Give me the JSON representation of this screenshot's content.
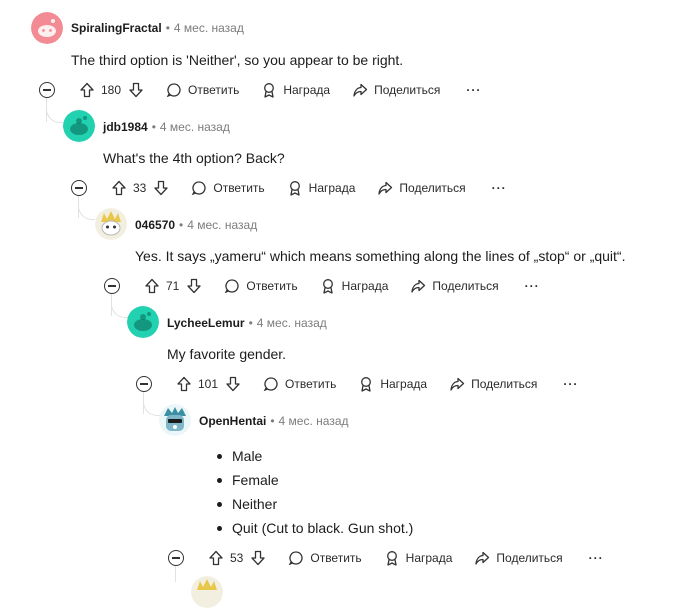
{
  "labels": {
    "reply": "Ответить",
    "award": "Награда",
    "share": "Поделиться",
    "more": "···"
  },
  "comments": [
    {
      "username": "SpiralingFractal",
      "time": "4 мес. назад",
      "text": "The third option is 'Neither', so you appear to be right.",
      "score": "180",
      "avatar_color": "#f28b94"
    },
    {
      "username": "jdb1984",
      "time": "4 мес. назад",
      "text": "What's the 4th option? Back?",
      "score": "33",
      "avatar_color": "#21d1b0"
    },
    {
      "username": "046570",
      "time": "4 мес. назад",
      "text": "Yes. It says „yameru“ which means something along the lines of „stop“ or „quit“.",
      "score": "71",
      "avatar_color": "#e9dfa8"
    },
    {
      "username": "LycheeLemur",
      "time": "4 мес. назад",
      "text": "My favorite gender.",
      "score": "101",
      "avatar_color": "#21d1b0"
    },
    {
      "username": "OpenHentai",
      "time": "4 мес. назад",
      "list": [
        "Male",
        "Female",
        "Neither",
        "Quit (Cut to black. Gun shot.)"
      ],
      "score": "53",
      "avatar_color": "#7fb7c9"
    }
  ]
}
